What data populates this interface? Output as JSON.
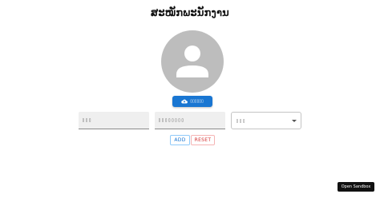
{
  "page": {
    "title": "ສະໝັກພະນັກງານ"
  },
  "avatar": {
    "icon": "person-icon"
  },
  "upload": {
    "label": "▯▯▯▯▯▯",
    "icon": "cloud-upload-icon"
  },
  "form": {
    "field1_label": "▯▯▯",
    "field2_label": "▯▯▯▯▯▯▯▯",
    "select_label": "▯▯▯"
  },
  "actions": {
    "add_label": "ADD",
    "reset_label": "RESET"
  },
  "footer": {
    "sandbox_label": "Open Sandbox"
  },
  "colors": {
    "primary": "#1976d2",
    "danger": "#d32f2f",
    "avatar_bg": "#bdbdbd"
  }
}
